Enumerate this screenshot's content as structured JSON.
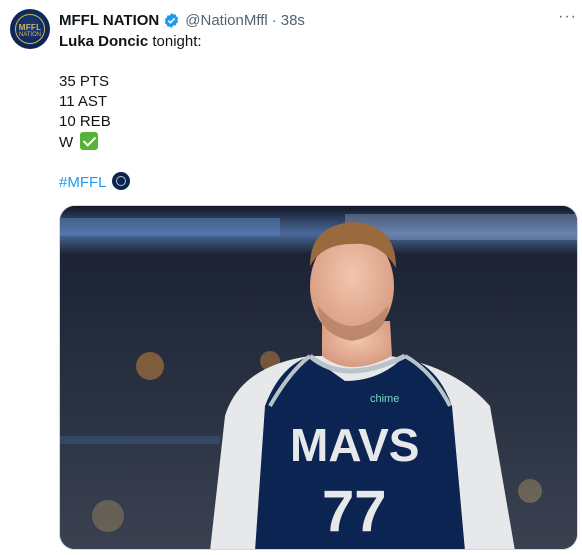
{
  "tweet": {
    "author_name": "MFFL NATION",
    "author_handle": "@NationMffl",
    "separator": "·",
    "timestamp": "38s",
    "more_label": "···",
    "lines": {
      "player": "Luka Doncic",
      "tonight": " tonight:",
      "pts": "35 PTS",
      "ast": "11 AST",
      "reb": "10 REB",
      "result": "W"
    },
    "hashtag": "#MFFL"
  },
  "avatar": {
    "text": "MFFL",
    "subtext": "NATION"
  },
  "media": {
    "jersey_text": "MAVS",
    "jersey_number": "77",
    "sponsor": "chime"
  },
  "colors": {
    "accent": "#1d9bf0",
    "text": "#0f1419",
    "muted": "#536471",
    "jersey": "#0b2452"
  },
  "icons": {
    "verified": "verified-badge-icon",
    "more": "more-options-icon",
    "check": "check-mark-emoji",
    "mavs": "mavericks-logo-emoji"
  }
}
